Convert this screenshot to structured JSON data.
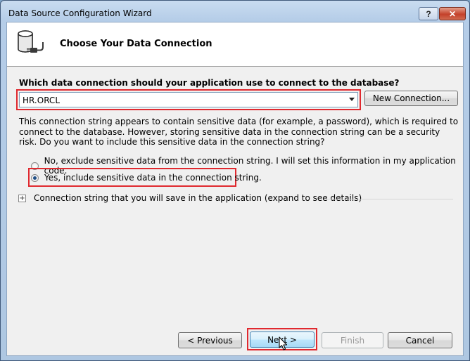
{
  "window": {
    "title": "Data Source Configuration Wizard",
    "help_label": "?",
    "close_label": "✕"
  },
  "header": {
    "title": "Choose Your Data Connection",
    "icon": "database-connection-icon"
  },
  "connection": {
    "question": "Which data connection should your application use to connect to the database?",
    "selected": "HR.ORCL",
    "new_connection_label": "New Connection..."
  },
  "sensitive": {
    "note": "This connection string appears to contain sensitive data (for example, a password), which is required to connect to the database. However, storing sensitive data in the connection string can be a security risk. Do you want to include this sensitive data in the connection string?",
    "option_no": "No, exclude sensitive data from the connection string. I will set this information in my application code.",
    "option_yes": "Yes, include sensitive data in the connection string.",
    "selected": "yes"
  },
  "expander": {
    "symbol": "+",
    "label": "Connection string that you will save in the application (expand to see details)"
  },
  "buttons": {
    "previous": "< Previous",
    "next": "Next >",
    "finish": "Finish",
    "cancel": "Cancel"
  },
  "colors": {
    "highlight": "#e0292f",
    "title_bar": "#b5cde8"
  }
}
